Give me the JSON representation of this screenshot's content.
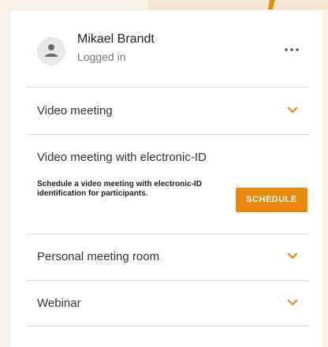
{
  "user": {
    "name": "Mikael Brandt",
    "status": "Logged in"
  },
  "sections": [
    {
      "label": "Video meeting",
      "icon": "chevron-down-icon"
    },
    {
      "label": "Personal meeting room",
      "icon": "chevron-down-icon"
    },
    {
      "label": "Webinar",
      "icon": "chevron-down-icon"
    }
  ],
  "eid": {
    "title": "Video meeting with electronic-ID",
    "description": "Schedule a video meeting with electronic-ID identification for participants.",
    "button_label": "SCHEDULE"
  },
  "colors": {
    "accent": "#e7890c",
    "background": "#fbf3ea",
    "divider": "#d9d9d9"
  }
}
